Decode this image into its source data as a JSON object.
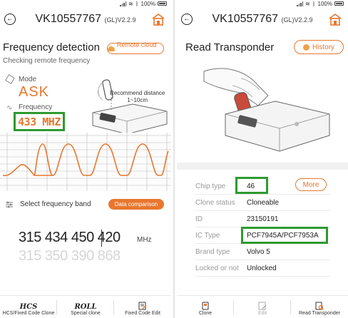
{
  "device_title": "VK10557767",
  "version": "(GL)V2.2.9",
  "status": {
    "battery": "100%"
  },
  "colors": {
    "accent": "#e8772e",
    "highlight": "#2e9a30",
    "muted": "#999999"
  },
  "left": {
    "section_title": "Frequency detection",
    "subtitle": "Checking remote frequency",
    "remote_cloud_label": "Remote cloud ...",
    "mode_label": "Mode",
    "mode_value": "ASK",
    "frequency_label": "Frequency",
    "frequency_value": "433 MHZ",
    "recommend_line1": "Recommend distance",
    "recommend_line2": "1~10cm",
    "select_band_label": "Select frequency band",
    "data_comparison_label": "Data comparison",
    "freq_numbers": "315 434 450 420",
    "freq_numbers_ghost": "315 350 390 868",
    "unit": "MHz",
    "nav": [
      {
        "icon": "hcs-logo",
        "logo": "HCS",
        "label": "HCS/Fixed Code Clone"
      },
      {
        "icon": "roll-logo",
        "logo": "ROLL",
        "label": "Special clone"
      },
      {
        "icon": "edit-icon",
        "label": "Fixed Code Edit"
      }
    ]
  },
  "right": {
    "section_title": "Read Transponder",
    "history_label": "History",
    "more_label": "More",
    "info": [
      {
        "key": "Chip type",
        "value": "46"
      },
      {
        "key": "Clone status",
        "value": "Cloneable"
      },
      {
        "key": "ID",
        "value": "23150191"
      },
      {
        "key": "IC Type",
        "value": "PCF7945A/PCF7953A"
      },
      {
        "key": "Brand type",
        "value": "Volvo 5"
      },
      {
        "key": "Locked or not",
        "value": "Unlocked"
      }
    ],
    "nav": [
      {
        "icon": "clone-icon",
        "label": "Clone"
      },
      {
        "icon": "edit-icon",
        "label": "Edit"
      },
      {
        "icon": "read-transponder-icon",
        "label": "Read Transponder"
      }
    ]
  }
}
